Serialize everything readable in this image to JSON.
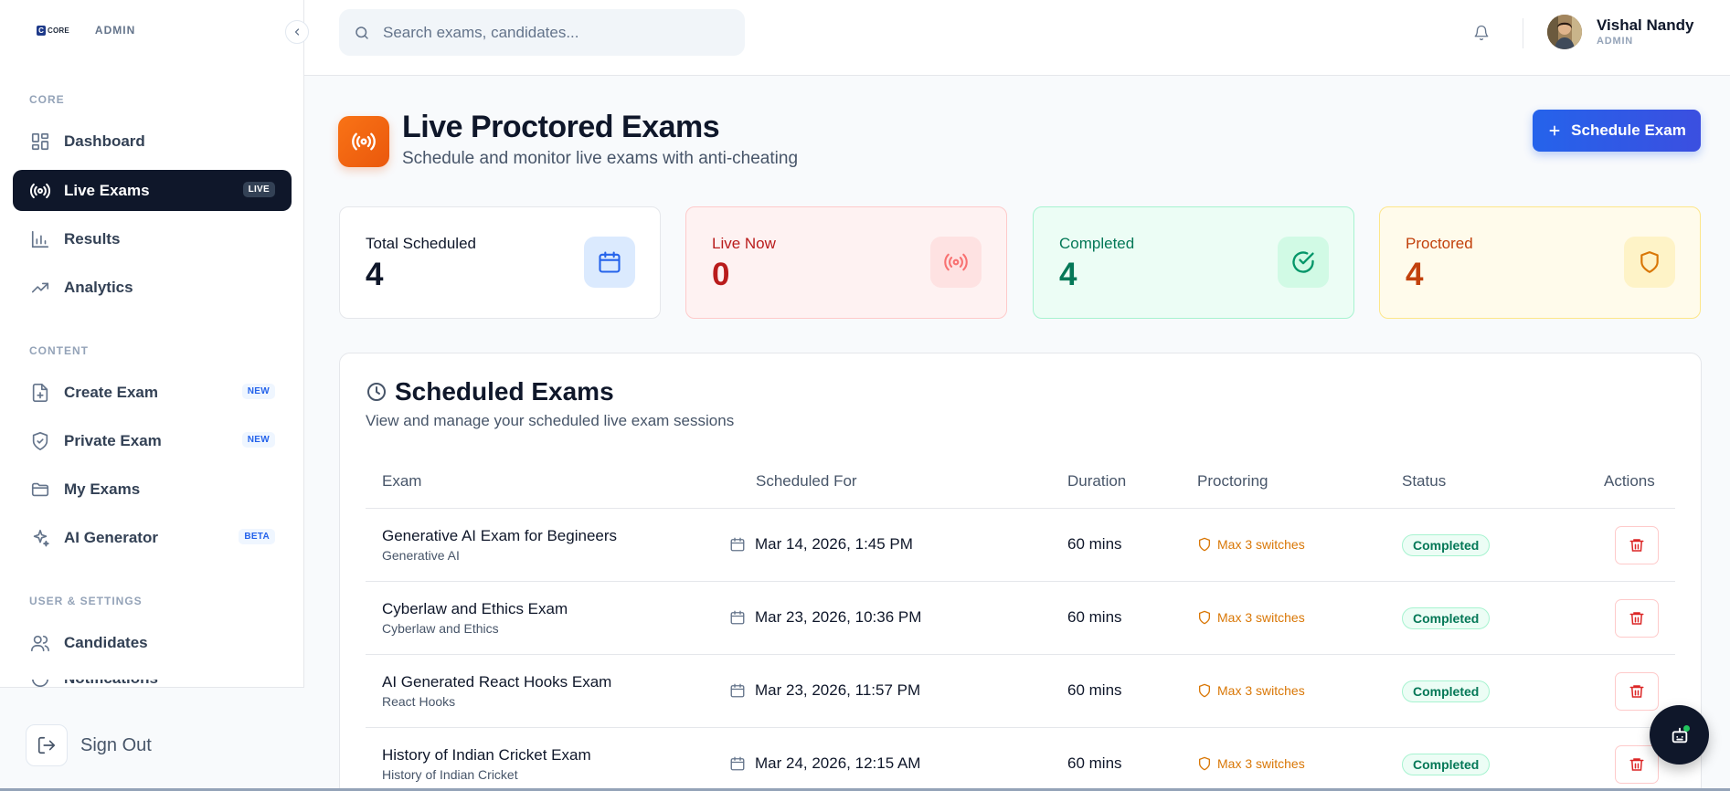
{
  "brand": {
    "logo_mark": "C",
    "logo_word": "CORE",
    "admin_label": "ADMIN"
  },
  "sidebar": {
    "sections": {
      "core": "CORE",
      "content": "CONTENT",
      "user_settings": "USER & SETTINGS"
    },
    "items": [
      {
        "label": "Dashboard",
        "icon": "grid-icon"
      },
      {
        "label": "Live Exams",
        "icon": "broadcast-icon",
        "badge": "LIVE",
        "active": true
      },
      {
        "label": "Results",
        "icon": "bar-chart-icon"
      },
      {
        "label": "Analytics",
        "icon": "trending-icon"
      },
      {
        "label": "Create Exam",
        "icon": "file-plus-icon",
        "badge": "NEW"
      },
      {
        "label": "Private Exam",
        "icon": "shield-icon",
        "badge": "NEW"
      },
      {
        "label": "My Exams",
        "icon": "folder-icon"
      },
      {
        "label": "AI Generator",
        "icon": "sparkles-icon",
        "badge": "BETA"
      },
      {
        "label": "Candidates",
        "icon": "users-icon"
      },
      {
        "label": "Notifications",
        "icon": "bell-icon"
      }
    ],
    "sign_out": "Sign Out"
  },
  "topbar": {
    "search_placeholder": "Search exams, candidates...",
    "user": {
      "name": "Vishal Nandy",
      "role": "ADMIN"
    }
  },
  "header": {
    "title": "Live Proctored Exams",
    "subtitle": "Schedule and monitor live exams with anti-cheating",
    "schedule_button": "Schedule Exam"
  },
  "stats": [
    {
      "label": "Total Scheduled",
      "value": "4",
      "icon": "calendar-icon",
      "color": "#0f172a",
      "bg": "#ffffff",
      "border": "#e5e7eb",
      "icon_bg": "#dbeafe",
      "icon_color": "#2563eb"
    },
    {
      "label": "Live Now",
      "value": "0",
      "icon": "broadcast-icon",
      "color": "#b91c1c",
      "bg": "#fef2f2",
      "border": "#fecaca",
      "icon_bg": "#fee2e2",
      "icon_color": "#f87171"
    },
    {
      "label": "Completed",
      "value": "4",
      "icon": "check-circle-icon",
      "color": "#047857",
      "bg": "#ecfdf5",
      "border": "#a7f3d0",
      "icon_bg": "#d1fae5",
      "icon_color": "#059669"
    },
    {
      "label": "Proctored",
      "value": "4",
      "icon": "shield-icon",
      "color": "#c2410c",
      "bg": "#fffbeb",
      "border": "#fde68a",
      "icon_bg": "#fef3c7",
      "icon_color": "#d97706"
    }
  ],
  "table": {
    "title": "Scheduled Exams",
    "subtitle": "View and manage your scheduled live exam sessions",
    "columns": [
      "Exam",
      "Scheduled For",
      "Duration",
      "Proctoring",
      "Status",
      "Actions"
    ],
    "rows": [
      {
        "name": "Generative AI Exam for Begineers",
        "category": "Generative AI",
        "scheduled": "Mar 14, 2026, 1:45 PM",
        "duration": "60 mins",
        "proctoring": "Max 3 switches",
        "status": "Completed"
      },
      {
        "name": "Cyberlaw and Ethics Exam",
        "category": "Cyberlaw and Ethics",
        "scheduled": "Mar 23, 2026, 10:36 PM",
        "duration": "60 mins",
        "proctoring": "Max 3 switches",
        "status": "Completed"
      },
      {
        "name": "AI Generated React Hooks Exam",
        "category": "React Hooks",
        "scheduled": "Mar 23, 2026, 11:57 PM",
        "duration": "60 mins",
        "proctoring": "Max 3 switches",
        "status": "Completed"
      },
      {
        "name": "History of Indian Cricket Exam",
        "category": "History of Indian Cricket",
        "scheduled": "Mar 24, 2026, 12:15 AM",
        "duration": "60 mins",
        "proctoring": "Max 3 switches",
        "status": "Completed"
      }
    ]
  }
}
